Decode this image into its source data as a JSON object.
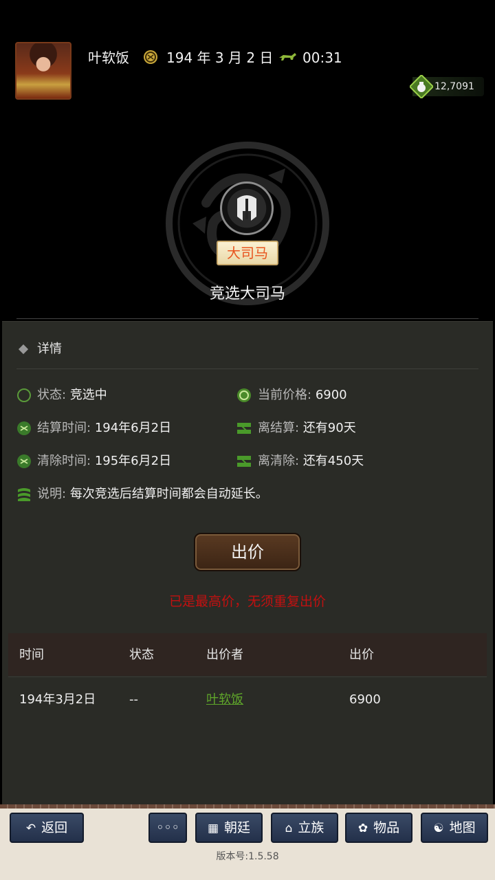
{
  "header": {
    "player_name": "叶软饭",
    "date": "194 年 3 月 2 日",
    "time": "00:31",
    "money": "12,7091"
  },
  "office": {
    "badge": "大司马",
    "title": "竞选大司马"
  },
  "details": {
    "heading": "详情",
    "status_label": "状态:",
    "status_value": "竞选中",
    "price_label": "当前价格:",
    "price_value": "6900",
    "settle_label": "结算时间:",
    "settle_value": "194年6月2日",
    "to_settle_label": "离结算:",
    "to_settle_value": "还有90天",
    "clear_label": "清除时间:",
    "clear_value": "195年6月2日",
    "to_clear_label": "离清除:",
    "to_clear_value": "还有450天",
    "note_label": "说明:",
    "note_value": "每次竞选后结算时间都会自动延长。"
  },
  "bid_button": "出价",
  "warning": "已是最高价，无须重复出价",
  "table": {
    "headers": [
      "时间",
      "状态",
      "出价者",
      "出价"
    ],
    "rows": [
      [
        "194年3月2日",
        "--",
        "叶软饭",
        "6900"
      ]
    ]
  },
  "nav": {
    "back": "返回",
    "more": "◦◦◦",
    "court": "朝廷",
    "clan": "立族",
    "items": "物品",
    "map": "地图"
  },
  "version": "版本号:1.5.58",
  "colors": {
    "accent_green": "#5fa62a",
    "warning_red": "#c41010",
    "badge_text": "#e8541e"
  }
}
